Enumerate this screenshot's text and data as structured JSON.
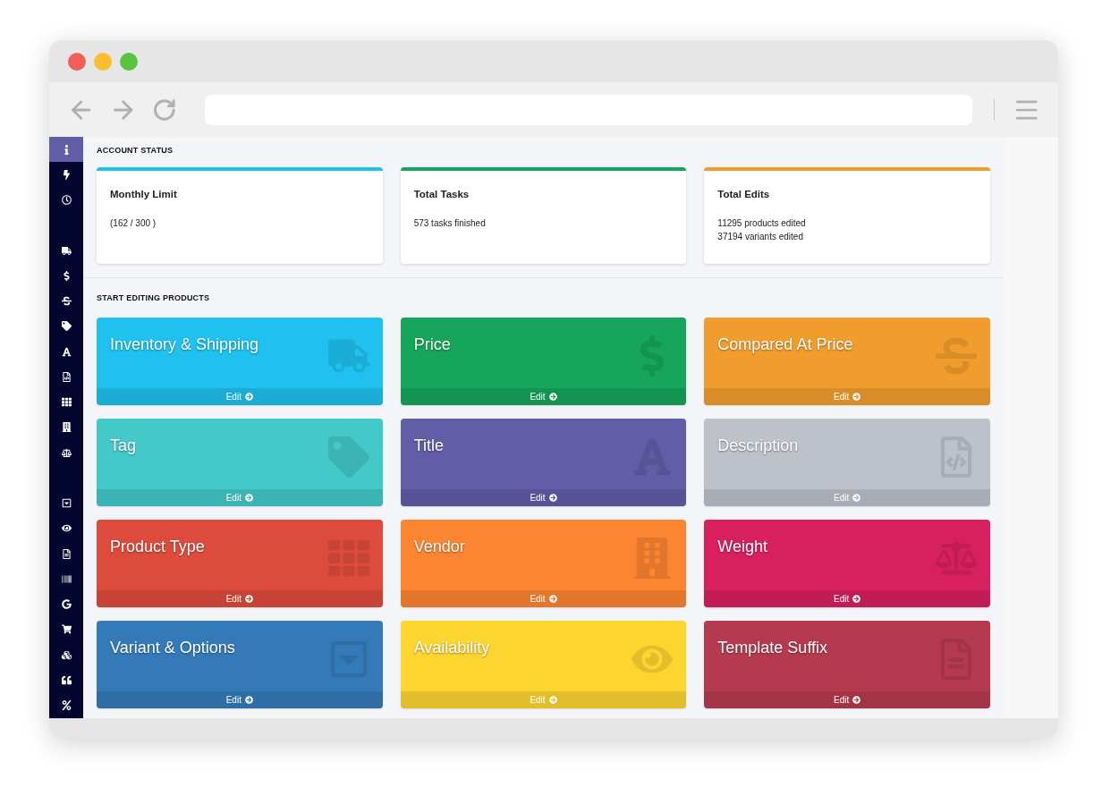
{
  "sidebar": {
    "groups": [
      [
        {
          "kind": "info",
          "selected": true
        },
        {
          "kind": "bolt",
          "selected": false
        },
        {
          "kind": "clock",
          "selected": false
        }
      ],
      [
        {
          "kind": "truck",
          "selected": false
        },
        {
          "kind": "dollar",
          "selected": false
        },
        {
          "kind": "strike",
          "selected": false
        },
        {
          "kind": "tag",
          "selected": false
        },
        {
          "kind": "font",
          "selected": false
        },
        {
          "kind": "filecode",
          "selected": false
        },
        {
          "kind": "grid",
          "selected": false
        },
        {
          "kind": "building",
          "selected": false
        },
        {
          "kind": "scale",
          "selected": false
        }
      ],
      [
        {
          "kind": "caretbox",
          "selected": false
        },
        {
          "kind": "eye",
          "selected": false
        },
        {
          "kind": "filetext",
          "selected": false
        },
        {
          "kind": "barcode",
          "selected": false
        },
        {
          "kind": "google",
          "selected": false
        },
        {
          "kind": "cart",
          "selected": false
        },
        {
          "kind": "cubes",
          "selected": false
        },
        {
          "kind": "quote",
          "selected": false
        },
        {
          "kind": "percent",
          "selected": false
        }
      ]
    ]
  },
  "account_status": {
    "heading": "ACCOUNT STATUS",
    "cards": [
      {
        "title": "Monthly Limit",
        "lines": [
          "(162 / 300 )"
        ],
        "color": "#1fc1ee"
      },
      {
        "title": "Total Tasks",
        "lines": [
          "573 tasks finished"
        ],
        "color": "#16a55a"
      },
      {
        "title": "Total Edits",
        "lines": [
          "11295 products edited",
          "37194 variants edited"
        ],
        "color": "#f19d2d"
      }
    ]
  },
  "editing": {
    "heading": "START EDITING PRODUCTS",
    "tiles": [
      {
        "title": "Inventory & Shipping",
        "kind": "truck",
        "color": "#1fc1ee",
        "action": "Edit"
      },
      {
        "title": "Price",
        "kind": "dollar",
        "color": "#16a55a",
        "action": "Edit"
      },
      {
        "title": "Compared At Price",
        "kind": "strike",
        "color": "#f19d2d",
        "action": "Edit"
      },
      {
        "title": "Tag",
        "kind": "tag",
        "color": "#44c9c9",
        "action": "Edit"
      },
      {
        "title": "Title",
        "kind": "font",
        "color": "#625da7",
        "action": "Edit"
      },
      {
        "title": "Description",
        "kind": "filecode",
        "color": "#bcc1ca",
        "action": "Edit"
      },
      {
        "title": "Product Type",
        "kind": "grid",
        "color": "#dd4b3d",
        "action": "Edit"
      },
      {
        "title": "Vendor",
        "kind": "building",
        "color": "#fc8531",
        "action": "Edit"
      },
      {
        "title": "Weight",
        "kind": "scale",
        "color": "#d8205f",
        "action": "Edit"
      },
      {
        "title": "Variant & Options",
        "kind": "caretbox",
        "color": "#357ab8",
        "action": "Edit"
      },
      {
        "title": "Availability",
        "kind": "eye",
        "color": "#fcd52f",
        "action": "Edit"
      },
      {
        "title": "Template Suffix",
        "kind": "filetext",
        "color": "#b63a4f",
        "action": "Edit"
      }
    ]
  }
}
